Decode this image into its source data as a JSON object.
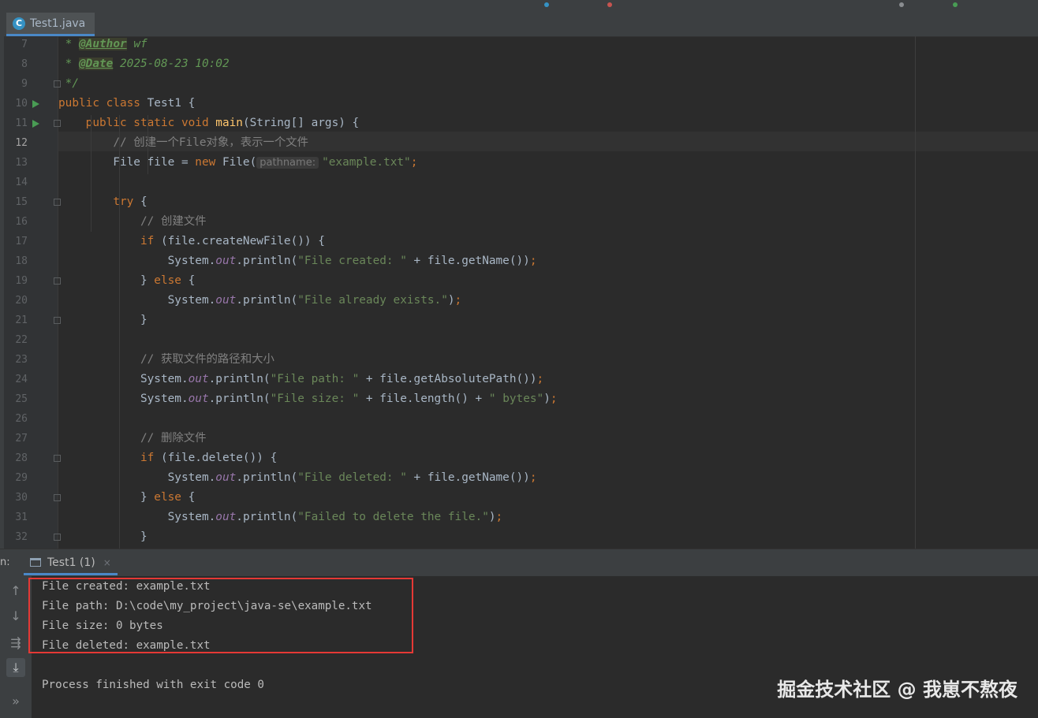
{
  "editor": {
    "tab_label": "Test1.java",
    "tab_icon": "java-class-icon",
    "lines": [
      {
        "n": "7",
        "segs": [
          [
            "jd",
            " * "
          ],
          [
            "tag",
            "@Author"
          ],
          [
            "jd",
            " wf"
          ]
        ]
      },
      {
        "n": "8",
        "segs": [
          [
            "jd",
            " * "
          ],
          [
            "tag",
            "@Date"
          ],
          [
            "jd",
            " 2025-08-23 10:02"
          ]
        ]
      },
      {
        "n": "9",
        "segs": [
          [
            "jd",
            " */"
          ]
        ]
      },
      {
        "n": "10",
        "segs": [
          [
            "kw",
            "public class "
          ],
          [
            "p",
            "Test1 {"
          ]
        ]
      },
      {
        "n": "11",
        "segs": [
          [
            "p",
            "    "
          ],
          [
            "kw",
            "public static void "
          ],
          [
            "fn",
            "main"
          ],
          [
            "p",
            "(String[] args) {"
          ]
        ]
      },
      {
        "n": "12",
        "segs": [
          [
            "p",
            "        "
          ],
          [
            "cm",
            "// 创建一个File对象，表示一个文件"
          ]
        ]
      },
      {
        "n": "13",
        "segs": [
          [
            "p",
            "        File file = "
          ],
          [
            "kw",
            "new "
          ],
          [
            "p",
            "File("
          ],
          [
            "hint",
            "pathname:"
          ],
          [
            "str",
            "\"example.txt\""
          ],
          [
            "kw",
            ";"
          ]
        ]
      },
      {
        "n": "14",
        "segs": []
      },
      {
        "n": "15",
        "segs": [
          [
            "p",
            "        "
          ],
          [
            "kw",
            "try "
          ],
          [
            "p",
            "{"
          ]
        ]
      },
      {
        "n": "16",
        "segs": [
          [
            "p",
            "            "
          ],
          [
            "cm",
            "// 创建文件"
          ]
        ]
      },
      {
        "n": "17",
        "segs": [
          [
            "p",
            "            "
          ],
          [
            "kw",
            "if "
          ],
          [
            "p",
            "(file.createNewFile()) {"
          ]
        ]
      },
      {
        "n": "18",
        "segs": [
          [
            "p",
            "                System."
          ],
          [
            "fld",
            "out"
          ],
          [
            "p",
            ".println("
          ],
          [
            "str",
            "\"File created: \""
          ],
          [
            "p",
            " + file.getName())"
          ],
          [
            "kw",
            ";"
          ]
        ]
      },
      {
        "n": "19",
        "segs": [
          [
            "p",
            "            } "
          ],
          [
            "kw",
            "else "
          ],
          [
            "p",
            "{"
          ]
        ]
      },
      {
        "n": "20",
        "segs": [
          [
            "p",
            "                System."
          ],
          [
            "fld",
            "out"
          ],
          [
            "p",
            ".println("
          ],
          [
            "str",
            "\"File already exists.\""
          ],
          [
            "p",
            ")"
          ],
          [
            "kw",
            ";"
          ]
        ]
      },
      {
        "n": "21",
        "segs": [
          [
            "p",
            "            }"
          ]
        ]
      },
      {
        "n": "22",
        "segs": []
      },
      {
        "n": "23",
        "segs": [
          [
            "p",
            "            "
          ],
          [
            "cm",
            "// 获取文件的路径和大小"
          ]
        ]
      },
      {
        "n": "24",
        "segs": [
          [
            "p",
            "            System."
          ],
          [
            "fld",
            "out"
          ],
          [
            "p",
            ".println("
          ],
          [
            "str",
            "\"File path: \""
          ],
          [
            "p",
            " + file.getAbsolutePath())"
          ],
          [
            "kw",
            ";"
          ]
        ]
      },
      {
        "n": "25",
        "segs": [
          [
            "p",
            "            System."
          ],
          [
            "fld",
            "out"
          ],
          [
            "p",
            ".println("
          ],
          [
            "str",
            "\"File size: \""
          ],
          [
            "p",
            " + file.length() + "
          ],
          [
            "str",
            "\" bytes\""
          ],
          [
            "p",
            ")"
          ],
          [
            "kw",
            ";"
          ]
        ]
      },
      {
        "n": "26",
        "segs": []
      },
      {
        "n": "27",
        "segs": [
          [
            "p",
            "            "
          ],
          [
            "cm",
            "// 删除文件"
          ]
        ]
      },
      {
        "n": "28",
        "segs": [
          [
            "p",
            "            "
          ],
          [
            "kw",
            "if "
          ],
          [
            "p",
            "(file.delete()) {"
          ]
        ]
      },
      {
        "n": "29",
        "segs": [
          [
            "p",
            "                System."
          ],
          [
            "fld",
            "out"
          ],
          [
            "p",
            ".println("
          ],
          [
            "str",
            "\"File deleted: \""
          ],
          [
            "p",
            " + file.getName())"
          ],
          [
            "kw",
            ";"
          ]
        ]
      },
      {
        "n": "30",
        "segs": [
          [
            "p",
            "            } "
          ],
          [
            "kw",
            "else "
          ],
          [
            "p",
            "{"
          ]
        ]
      },
      {
        "n": "31",
        "segs": [
          [
            "p",
            "                System."
          ],
          [
            "fld",
            "out"
          ],
          [
            "p",
            ".println("
          ],
          [
            "str",
            "\"Failed to delete the file.\""
          ],
          [
            "p",
            ")"
          ],
          [
            "kw",
            ";"
          ]
        ]
      },
      {
        "n": "32",
        "segs": [
          [
            "p",
            "            }"
          ]
        ]
      }
    ]
  },
  "run_panel": {
    "prefix": "n:",
    "tab_label": "Test1 (1)",
    "tab_close": "×",
    "output": [
      "File created: example.txt",
      "File path: D:\\code\\my_project\\java-se\\example.txt",
      "File size: 0 bytes",
      "File deleted: example.txt",
      "",
      "Process finished with exit code 0"
    ],
    "tools": [
      {
        "name": "scroll-up-icon",
        "glyph": "↑"
      },
      {
        "name": "scroll-down-icon",
        "glyph": "↓"
      },
      {
        "name": "soft-wrap-icon",
        "glyph": "⇶"
      },
      {
        "name": "scroll-to-end-icon",
        "glyph": "⤓"
      },
      {
        "name": "more-icon",
        "glyph": "»"
      }
    ]
  },
  "watermark": "掘金技术社区 @ 我崽不熬夜",
  "colors": {
    "keyword": "#cc7832",
    "string": "#6a8759",
    "comment": "#808080",
    "javadoc": "#629755",
    "field": "#9876aa",
    "method": "#ffc66d",
    "highlight_box": "#e53935"
  }
}
